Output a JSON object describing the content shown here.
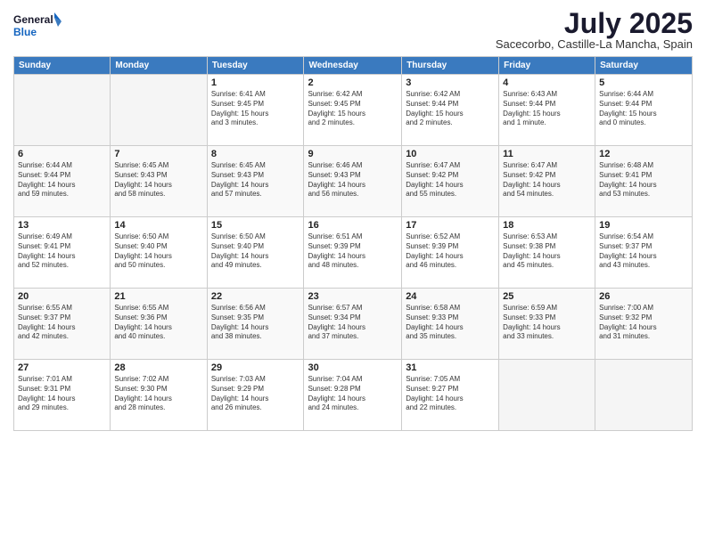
{
  "header": {
    "logo_line1": "General",
    "logo_line2": "Blue",
    "month_title": "July 2025",
    "location": "Sacecorbo, Castille-La Mancha, Spain"
  },
  "days_of_week": [
    "Sunday",
    "Monday",
    "Tuesday",
    "Wednesday",
    "Thursday",
    "Friday",
    "Saturday"
  ],
  "weeks": [
    [
      {
        "day": "",
        "info": ""
      },
      {
        "day": "",
        "info": ""
      },
      {
        "day": "1",
        "info": "Sunrise: 6:41 AM\nSunset: 9:45 PM\nDaylight: 15 hours\nand 3 minutes."
      },
      {
        "day": "2",
        "info": "Sunrise: 6:42 AM\nSunset: 9:45 PM\nDaylight: 15 hours\nand 2 minutes."
      },
      {
        "day": "3",
        "info": "Sunrise: 6:42 AM\nSunset: 9:44 PM\nDaylight: 15 hours\nand 2 minutes."
      },
      {
        "day": "4",
        "info": "Sunrise: 6:43 AM\nSunset: 9:44 PM\nDaylight: 15 hours\nand 1 minute."
      },
      {
        "day": "5",
        "info": "Sunrise: 6:44 AM\nSunset: 9:44 PM\nDaylight: 15 hours\nand 0 minutes."
      }
    ],
    [
      {
        "day": "6",
        "info": "Sunrise: 6:44 AM\nSunset: 9:44 PM\nDaylight: 14 hours\nand 59 minutes."
      },
      {
        "day": "7",
        "info": "Sunrise: 6:45 AM\nSunset: 9:43 PM\nDaylight: 14 hours\nand 58 minutes."
      },
      {
        "day": "8",
        "info": "Sunrise: 6:45 AM\nSunset: 9:43 PM\nDaylight: 14 hours\nand 57 minutes."
      },
      {
        "day": "9",
        "info": "Sunrise: 6:46 AM\nSunset: 9:43 PM\nDaylight: 14 hours\nand 56 minutes."
      },
      {
        "day": "10",
        "info": "Sunrise: 6:47 AM\nSunset: 9:42 PM\nDaylight: 14 hours\nand 55 minutes."
      },
      {
        "day": "11",
        "info": "Sunrise: 6:47 AM\nSunset: 9:42 PM\nDaylight: 14 hours\nand 54 minutes."
      },
      {
        "day": "12",
        "info": "Sunrise: 6:48 AM\nSunset: 9:41 PM\nDaylight: 14 hours\nand 53 minutes."
      }
    ],
    [
      {
        "day": "13",
        "info": "Sunrise: 6:49 AM\nSunset: 9:41 PM\nDaylight: 14 hours\nand 52 minutes."
      },
      {
        "day": "14",
        "info": "Sunrise: 6:50 AM\nSunset: 9:40 PM\nDaylight: 14 hours\nand 50 minutes."
      },
      {
        "day": "15",
        "info": "Sunrise: 6:50 AM\nSunset: 9:40 PM\nDaylight: 14 hours\nand 49 minutes."
      },
      {
        "day": "16",
        "info": "Sunrise: 6:51 AM\nSunset: 9:39 PM\nDaylight: 14 hours\nand 48 minutes."
      },
      {
        "day": "17",
        "info": "Sunrise: 6:52 AM\nSunset: 9:39 PM\nDaylight: 14 hours\nand 46 minutes."
      },
      {
        "day": "18",
        "info": "Sunrise: 6:53 AM\nSunset: 9:38 PM\nDaylight: 14 hours\nand 45 minutes."
      },
      {
        "day": "19",
        "info": "Sunrise: 6:54 AM\nSunset: 9:37 PM\nDaylight: 14 hours\nand 43 minutes."
      }
    ],
    [
      {
        "day": "20",
        "info": "Sunrise: 6:55 AM\nSunset: 9:37 PM\nDaylight: 14 hours\nand 42 minutes."
      },
      {
        "day": "21",
        "info": "Sunrise: 6:55 AM\nSunset: 9:36 PM\nDaylight: 14 hours\nand 40 minutes."
      },
      {
        "day": "22",
        "info": "Sunrise: 6:56 AM\nSunset: 9:35 PM\nDaylight: 14 hours\nand 38 minutes."
      },
      {
        "day": "23",
        "info": "Sunrise: 6:57 AM\nSunset: 9:34 PM\nDaylight: 14 hours\nand 37 minutes."
      },
      {
        "day": "24",
        "info": "Sunrise: 6:58 AM\nSunset: 9:33 PM\nDaylight: 14 hours\nand 35 minutes."
      },
      {
        "day": "25",
        "info": "Sunrise: 6:59 AM\nSunset: 9:33 PM\nDaylight: 14 hours\nand 33 minutes."
      },
      {
        "day": "26",
        "info": "Sunrise: 7:00 AM\nSunset: 9:32 PM\nDaylight: 14 hours\nand 31 minutes."
      }
    ],
    [
      {
        "day": "27",
        "info": "Sunrise: 7:01 AM\nSunset: 9:31 PM\nDaylight: 14 hours\nand 29 minutes."
      },
      {
        "day": "28",
        "info": "Sunrise: 7:02 AM\nSunset: 9:30 PM\nDaylight: 14 hours\nand 28 minutes."
      },
      {
        "day": "29",
        "info": "Sunrise: 7:03 AM\nSunset: 9:29 PM\nDaylight: 14 hours\nand 26 minutes."
      },
      {
        "day": "30",
        "info": "Sunrise: 7:04 AM\nSunset: 9:28 PM\nDaylight: 14 hours\nand 24 minutes."
      },
      {
        "day": "31",
        "info": "Sunrise: 7:05 AM\nSunset: 9:27 PM\nDaylight: 14 hours\nand 22 minutes."
      },
      {
        "day": "",
        "info": ""
      },
      {
        "day": "",
        "info": ""
      }
    ]
  ]
}
